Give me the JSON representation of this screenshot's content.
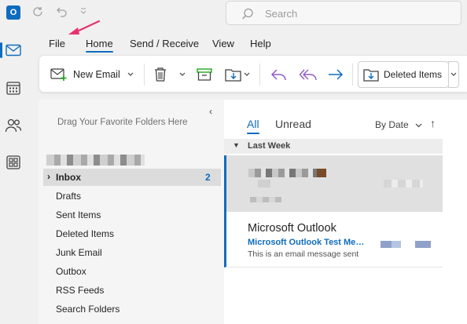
{
  "titlebar": {
    "app_logo": "O",
    "search_placeholder": "Search",
    "icons": [
      "sync-icon",
      "undo-icon",
      "customize-quick-access-icon"
    ]
  },
  "rail": [
    {
      "name": "mail",
      "icon": "mail-icon",
      "active": true
    },
    {
      "name": "calendar",
      "icon": "calendar-icon",
      "active": false
    },
    {
      "name": "people",
      "icon": "people-icon",
      "active": false
    },
    {
      "name": "apps",
      "icon": "apps-icon",
      "active": false
    }
  ],
  "menu": {
    "tabs": [
      "File",
      "Home",
      "Send / Receive",
      "View",
      "Help"
    ],
    "active": "Home"
  },
  "ribbon": {
    "new_email": "New Email",
    "move_to_folder": "Deleted Items"
  },
  "folder_pane": {
    "drag_hint": "Drag Your Favorite Folders Here",
    "inbox": {
      "label": "Inbox",
      "count": "2"
    },
    "folders": [
      "Drafts",
      "Sent Items",
      "Deleted Items",
      "Junk Email",
      "Outbox",
      "RSS Feeds",
      "Search Folders"
    ]
  },
  "message_list": {
    "filters": {
      "all": "All",
      "unread": "Unread"
    },
    "sort_label": "By Date",
    "group": "Last Week",
    "messages": [
      {
        "sender": "",
        "subject": "",
        "preview": "",
        "selected": true
      },
      {
        "sender": "Microsoft Outlook",
        "subject": "Microsoft Outlook Test Message",
        "preview": "This is an email message sent",
        "selected": false
      }
    ]
  },
  "colors": {
    "accent": "#0f6cbd",
    "annotation": "#e8336d",
    "selected_row": "#e0e0e0",
    "pane_bg": "#f5f5f5"
  }
}
